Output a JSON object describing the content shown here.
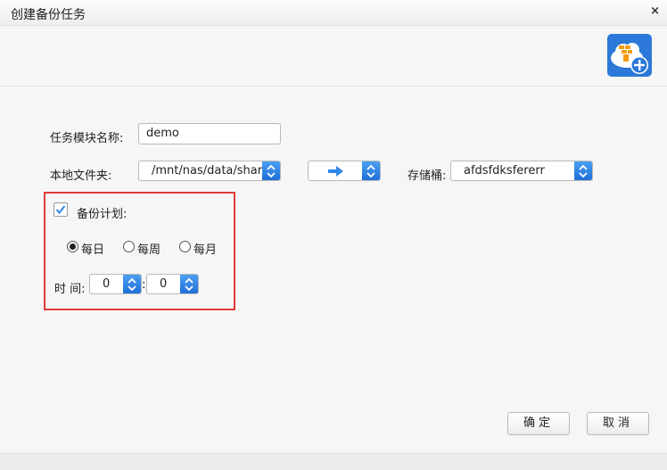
{
  "dialog": {
    "title": "创建备份任务"
  },
  "form": {
    "task_name_label": "任务模块名称:",
    "task_name_value": "demo",
    "local_folder_label": "本地文件夹:",
    "local_folder_value": "/mnt/nas/data/share",
    "direction_icon": "arrow-right-icon",
    "bucket_label": "存储桶:",
    "bucket_value": "afdsfdksfererr"
  },
  "schedule": {
    "enable_label": "备份计划:",
    "enabled": true,
    "frequency_options": [
      "每日",
      "每周",
      "每月"
    ],
    "frequency_selected": "每日",
    "time_label": "时 间:",
    "hour": "0",
    "separator": ":",
    "minute": "0"
  },
  "buttons": {
    "ok": "确定",
    "cancel": "取消"
  },
  "colors": {
    "accent": "#2f86e8",
    "highlight_border": "#e03a3a"
  }
}
